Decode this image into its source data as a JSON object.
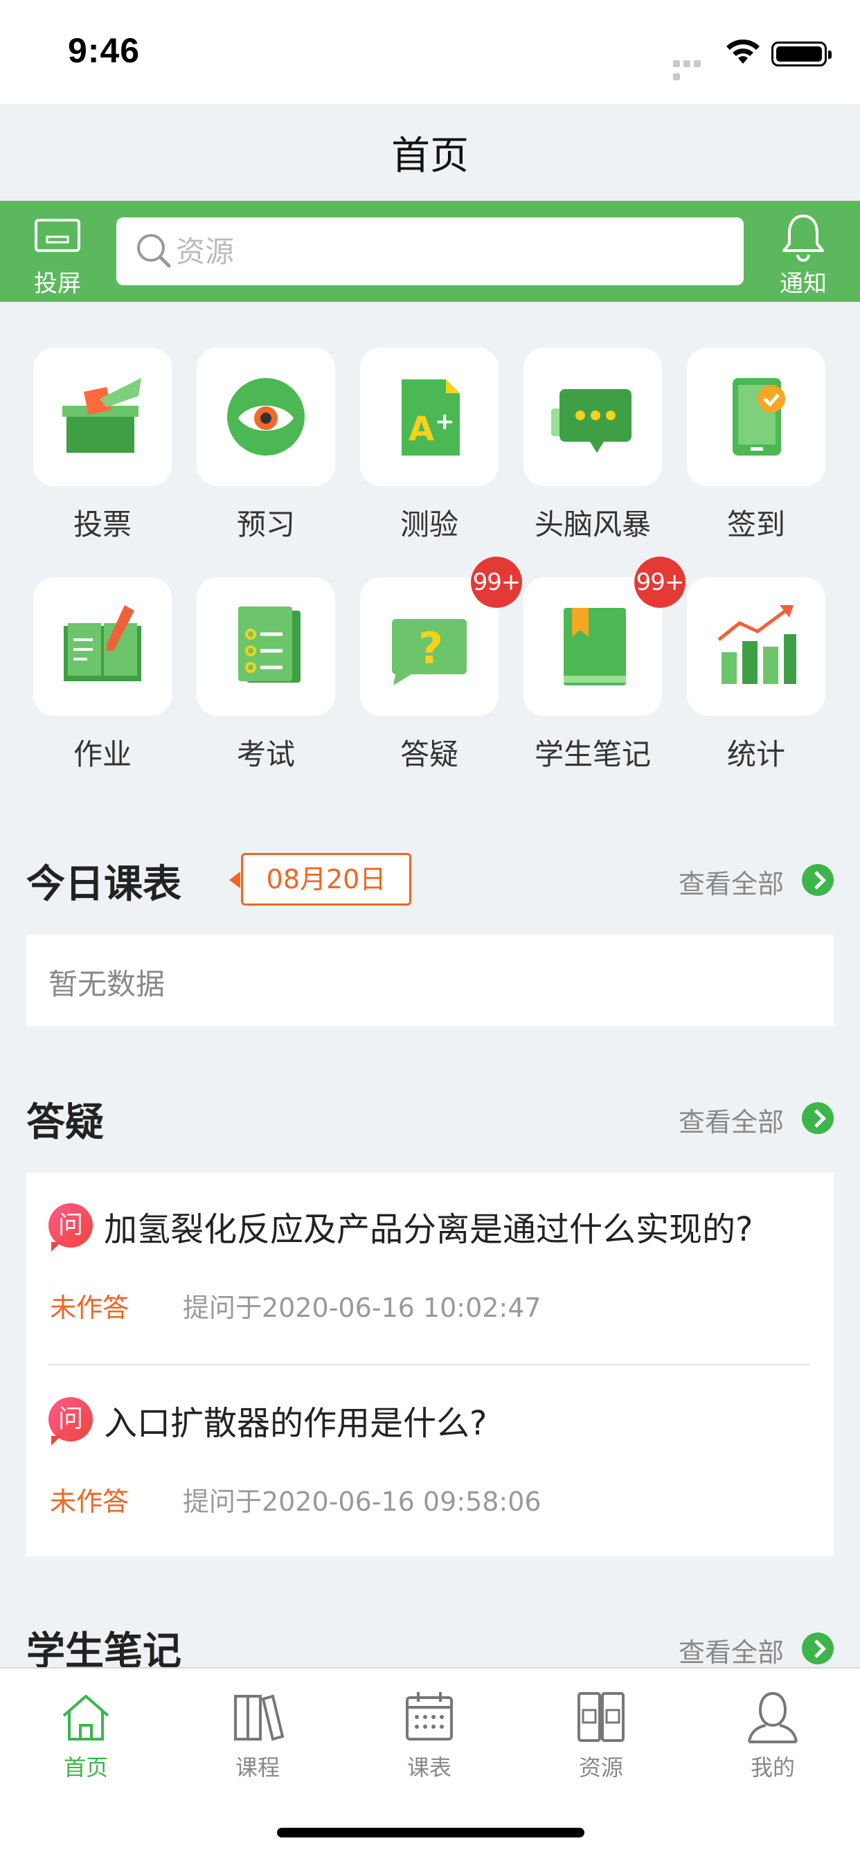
{
  "status_bar": {
    "time": "9:46"
  },
  "page": {
    "title": "首页"
  },
  "header": {
    "cast_label": "投屏",
    "search_placeholder": "资源",
    "notify_label": "通知"
  },
  "grid": [
    {
      "label": "投票",
      "icon": "vote-box-icon"
    },
    {
      "label": "预习",
      "icon": "eye-icon"
    },
    {
      "label": "测验",
      "icon": "quiz-grade-icon"
    },
    {
      "label": "头脑风暴",
      "icon": "chat-bubble-icon"
    },
    {
      "label": "签到",
      "icon": "check-in-phone-icon"
    },
    {
      "label": "作业",
      "icon": "homework-book-icon"
    },
    {
      "label": "考试",
      "icon": "exam-list-icon"
    },
    {
      "label": "答疑",
      "icon": "question-bubble-icon",
      "badge": "99+"
    },
    {
      "label": "学生笔记",
      "icon": "bookmark-book-icon",
      "badge": "99+"
    },
    {
      "label": "统计",
      "icon": "stats-chart-icon"
    }
  ],
  "schedule": {
    "title": "今日课表",
    "date": "08月20日",
    "see_all": "查看全部",
    "empty_text": "暂无数据"
  },
  "qa": {
    "title": "答疑",
    "see_all": "查看全部",
    "q_icon": "问",
    "items": [
      {
        "question": "加氢裂化反应及产品分离是通过什么实现的?",
        "status": "未作答",
        "time": "提问于2020-06-16 10:02:47"
      },
      {
        "question": "入口扩散器的作用是什么?",
        "status": "未作答",
        "time": "提问于2020-06-16 09:58:06"
      }
    ]
  },
  "notes": {
    "title": "学生笔记",
    "see_all": "查看全部"
  },
  "tabs": [
    {
      "label": "首页",
      "icon": "home-icon",
      "active": true
    },
    {
      "label": "课程",
      "icon": "books-icon"
    },
    {
      "label": "课表",
      "icon": "calendar-icon"
    },
    {
      "label": "资源",
      "icon": "resources-icon"
    },
    {
      "label": "我的",
      "icon": "profile-icon"
    }
  ],
  "colors": {
    "accent": "#5cb85c",
    "badge": "#e53935",
    "warning": "#f26522"
  }
}
